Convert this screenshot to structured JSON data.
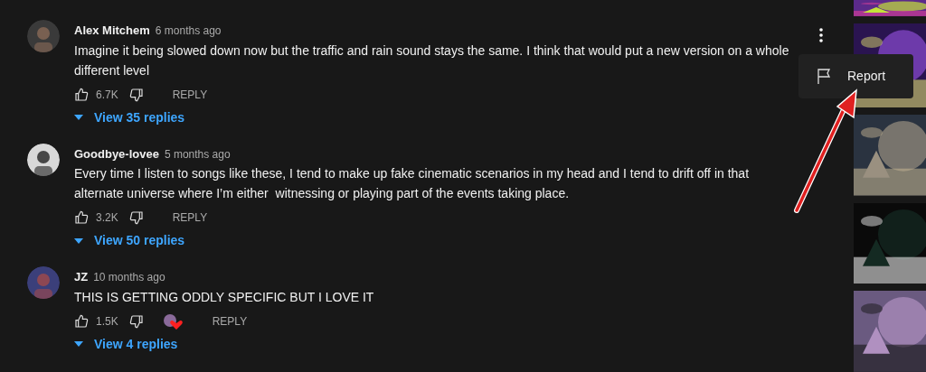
{
  "comments": [
    {
      "author": "Alex Mitchem",
      "time": "6 months ago",
      "text": "Imagine it being slowed down now but the traffic and rain sound stays the same. I think that would put a new version on a whole different level",
      "likes": "6.7K",
      "reply": "REPLY",
      "hearted": false,
      "view_replies": "View 35 replies",
      "menu_open": true
    },
    {
      "author": "Goodbye-lovee",
      "time": "5 months ago",
      "text": "Every time I listen to songs like these, I tend to make up fake cinematic scenarios in my head and I tend to drift off in that alternate universe where I’m either  witnessing or playing part of the events taking place.",
      "likes": "3.2K",
      "reply": "REPLY",
      "hearted": false,
      "view_replies": "View 50 replies",
      "menu_open": false
    },
    {
      "author": "JZ",
      "time": "10 months ago",
      "text": "THIS IS GETTING ODDLY SPECIFIC BUT I LOVE IT",
      "likes": "1.5K",
      "reply": "REPLY",
      "hearted": true,
      "view_replies": "View 4 replies",
      "menu_open": false
    }
  ],
  "menu": {
    "items": [
      {
        "label": "Report"
      }
    ]
  }
}
